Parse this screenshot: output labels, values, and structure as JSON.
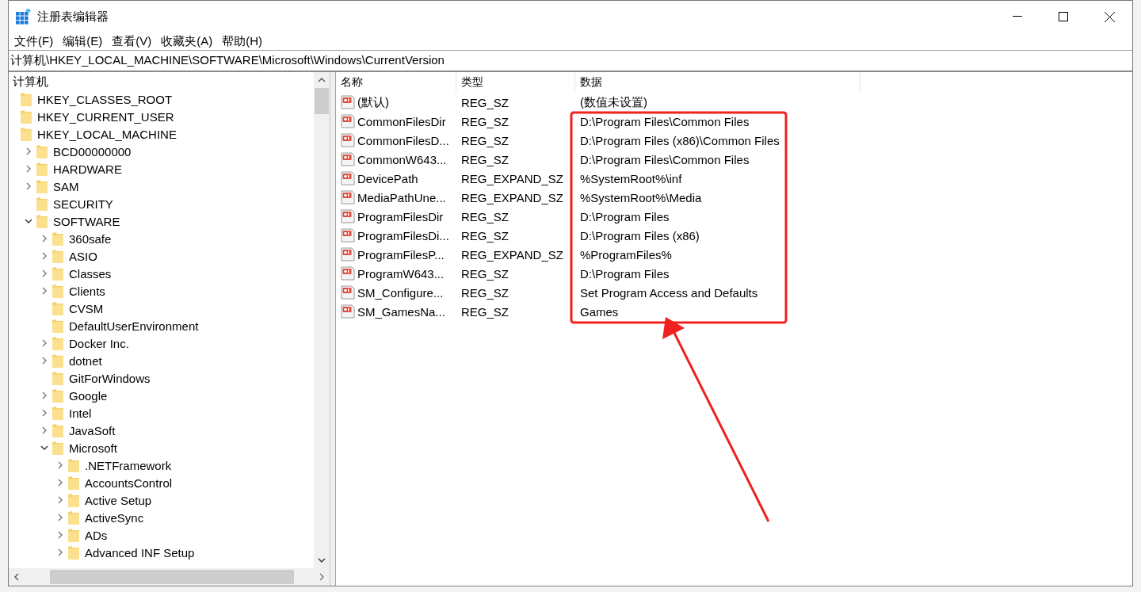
{
  "window": {
    "title": "注册表编辑器"
  },
  "menu": [
    "文件(F)",
    "编辑(E)",
    "查看(V)",
    "收藏夹(A)",
    "帮助(H)"
  ],
  "address": "计算机\\HKEY_LOCAL_MACHINE\\SOFTWARE\\Microsoft\\Windows\\CurrentVersion",
  "tree": {
    "label": "计算机",
    "children": [
      {
        "label": "HKEY_CLASSES_ROOT",
        "kind": "hive"
      },
      {
        "label": "HKEY_CURRENT_USER",
        "kind": "hive"
      },
      {
        "label": "HKEY_LOCAL_MACHINE",
        "kind": "hive",
        "children": [
          {
            "label": "BCD00000000",
            "kind": "branch",
            "expanded": false
          },
          {
            "label": "HARDWARE",
            "kind": "branch",
            "expanded": false
          },
          {
            "label": "SAM",
            "kind": "branch",
            "expanded": false
          },
          {
            "label": "SECURITY",
            "kind": "leaf"
          },
          {
            "label": "SOFTWARE",
            "kind": "branch",
            "expanded": true,
            "children": [
              {
                "label": "360safe",
                "kind": "branch",
                "expanded": false
              },
              {
                "label": "ASIO",
                "kind": "branch",
                "expanded": false
              },
              {
                "label": "Classes",
                "kind": "branch",
                "expanded": false
              },
              {
                "label": "Clients",
                "kind": "branch",
                "expanded": false
              },
              {
                "label": "CVSM",
                "kind": "leaf"
              },
              {
                "label": "DefaultUserEnvironment",
                "kind": "leaf"
              },
              {
                "label": "Docker Inc.",
                "kind": "branch",
                "expanded": false
              },
              {
                "label": "dotnet",
                "kind": "branch",
                "expanded": false
              },
              {
                "label": "GitForWindows",
                "kind": "leaf"
              },
              {
                "label": "Google",
                "kind": "branch",
                "expanded": false
              },
              {
                "label": "Intel",
                "kind": "branch",
                "expanded": false
              },
              {
                "label": "JavaSoft",
                "kind": "branch",
                "expanded": false
              },
              {
                "label": "Microsoft",
                "kind": "branch",
                "expanded": true,
                "children": [
                  {
                    "label": ".NETFramework",
                    "kind": "branch",
                    "expanded": false
                  },
                  {
                    "label": "AccountsControl",
                    "kind": "branch",
                    "expanded": false
                  },
                  {
                    "label": "Active Setup",
                    "kind": "branch",
                    "expanded": false
                  },
                  {
                    "label": "ActiveSync",
                    "kind": "branch",
                    "expanded": false
                  },
                  {
                    "label": "ADs",
                    "kind": "branch",
                    "expanded": false
                  },
                  {
                    "label": "Advanced INF Setup",
                    "kind": "branch",
                    "expanded": false
                  }
                ]
              }
            ]
          }
        ]
      }
    ]
  },
  "values": {
    "columns": [
      "名称",
      "类型",
      "数据"
    ],
    "rows": [
      {
        "name": "(默认)",
        "type": "REG_SZ",
        "data": "(数值未设置)"
      },
      {
        "name": "CommonFilesDir",
        "type": "REG_SZ",
        "data": "D:\\Program Files\\Common Files"
      },
      {
        "name": "CommonFilesD...",
        "type": "REG_SZ",
        "data": "D:\\Program Files (x86)\\Common Files"
      },
      {
        "name": "CommonW643...",
        "type": "REG_SZ",
        "data": "D:\\Program Files\\Common Files"
      },
      {
        "name": "DevicePath",
        "type": "REG_EXPAND_SZ",
        "data": "%SystemRoot%\\inf"
      },
      {
        "name": "MediaPathUne...",
        "type": "REG_EXPAND_SZ",
        "data": "%SystemRoot%\\Media"
      },
      {
        "name": "ProgramFilesDir",
        "type": "REG_SZ",
        "data": "D:\\Program Files"
      },
      {
        "name": "ProgramFilesDi...",
        "type": "REG_SZ",
        "data": "D:\\Program Files (x86)"
      },
      {
        "name": "ProgramFilesP...",
        "type": "REG_EXPAND_SZ",
        "data": "%ProgramFiles%"
      },
      {
        "name": "ProgramW643...",
        "type": "REG_SZ",
        "data": "D:\\Program Files"
      },
      {
        "name": "SM_Configure...",
        "type": "REG_SZ",
        "data": "Set Program Access and Defaults"
      },
      {
        "name": "SM_GamesNa...",
        "type": "REG_SZ",
        "data": "Games"
      }
    ]
  }
}
